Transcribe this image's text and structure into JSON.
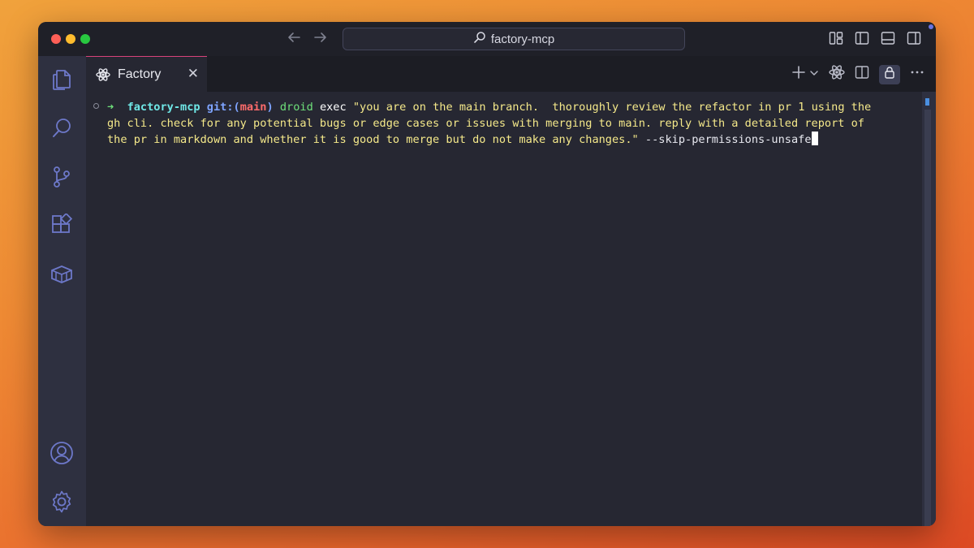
{
  "window": {
    "search_text": "factory-mcp"
  },
  "tab": {
    "label": "Factory",
    "close_glyph": "✕"
  },
  "terminal": {
    "prompt_arrow": "➜",
    "directory": "factory-mcp",
    "git_label": "git:(",
    "branch": "main",
    "git_close": ")",
    "command": "droid",
    "subcommand": "exec",
    "line1_text": "\"you are on the main branch.  thoroughly review the refactor in pr 1 using the",
    "line2_text": "gh cli. check for any potential bugs or edge cases or issues with merging to main. reply with a detailed report of",
    "line3_text": "the pr in markdown and whether it is good to merge but do not make any changes.\"",
    "flag": "--skip-permissions-unsafe"
  },
  "icons": {
    "activity_bar": [
      "files-icon",
      "search-icon",
      "source-control-icon",
      "extensions-icon",
      "containers-icon",
      "account-icon",
      "settings-icon"
    ],
    "title_bar": [
      "back-arrow-icon",
      "forward-arrow-icon",
      "search-icon",
      "customize-layout-icon",
      "toggle-primary-sidebar-icon",
      "toggle-panel-icon",
      "toggle-secondary-sidebar-icon"
    ],
    "tab_actions": [
      "new-terminal-icon",
      "dropdown-chevron-icon",
      "factory-logo-icon",
      "split-editor-icon",
      "lock-icon",
      "more-actions-icon"
    ]
  },
  "colors": {
    "accent_tab_border": "#d9437a",
    "prompt_arrow": "#6ee07a",
    "directory": "#6fe7e6",
    "branch": "#ff6b6b",
    "quoted_text": "#f5e98a"
  }
}
